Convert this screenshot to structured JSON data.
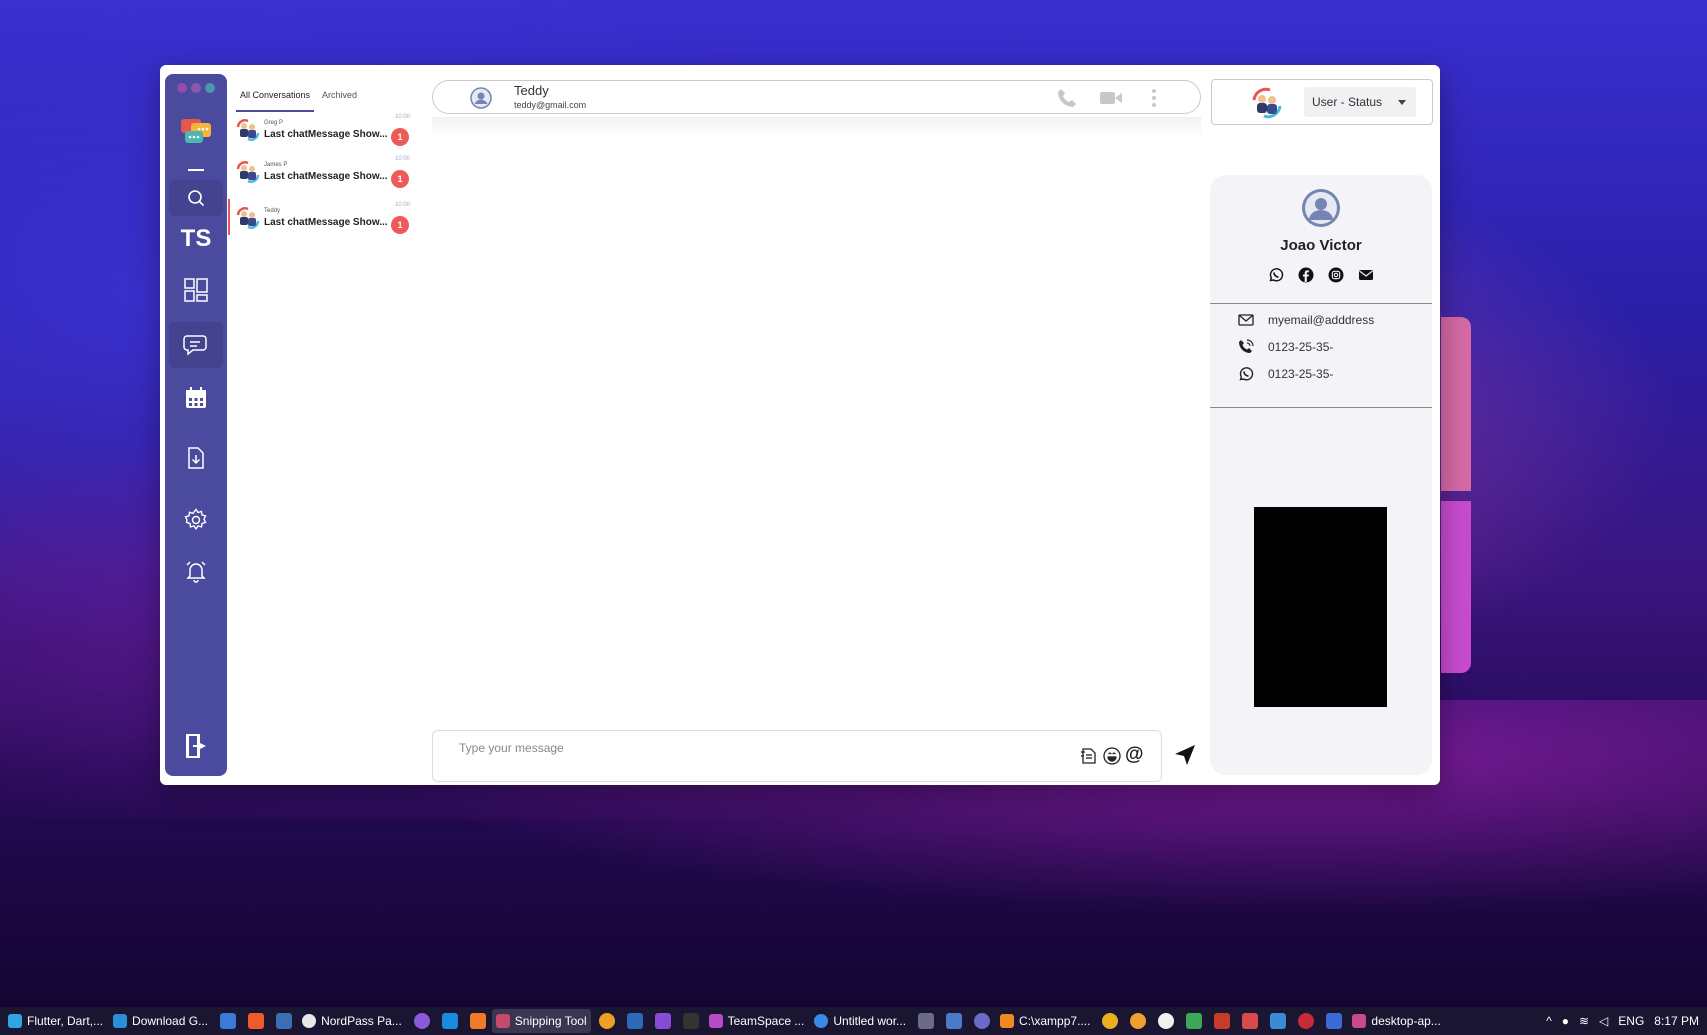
{
  "app": {
    "brand": "TS",
    "conversations_tabs": [
      "All Conversations",
      "Archived"
    ],
    "conversations": [
      {
        "name": "Greg P",
        "message": "Last chatMessage Show...",
        "time": "10:00",
        "unread": "1"
      },
      {
        "name": "James P",
        "message": "Last chatMessage Show...",
        "time": "10:00",
        "unread": "1"
      },
      {
        "name": "Teddy",
        "message": "Last chatMessage Show...",
        "time": "10:00",
        "unread": "1"
      }
    ],
    "chat_header": {
      "name": "Teddy",
      "email": "teddy@gmail.com"
    },
    "user_status": {
      "label": "User - Status"
    },
    "contact": {
      "name": "Joao Victor",
      "email": "myemail@adddress",
      "phone": "0123-25-35-",
      "whatsapp": "0123-25-35-"
    },
    "composer": {
      "placeholder": "Type your message",
      "mention_symbol": "@"
    }
  },
  "rail_icons": [
    "chat-logo-icon",
    "minus-icon",
    "search-icon",
    "dashboard-icon",
    "chat-icon",
    "calendar-icon",
    "file-download-icon",
    "settings-icon",
    "alarm-icon",
    "logout-icon"
  ],
  "colors": {
    "rail": "#4a4a9e",
    "badge": "#ee5a5a",
    "accent": "#4a4a9e"
  },
  "taskbar": {
    "items": [
      {
        "label": "Flutter, Dart,..."
      },
      {
        "label": "Download G..."
      },
      {
        "label": "NordPass Pa..."
      },
      {
        "label": "Snipping Tool"
      },
      {
        "label": "TeamSpace ..."
      },
      {
        "label": "Untitled wor..."
      },
      {
        "label": "C:\\xampp7...."
      },
      {
        "label": "desktop-ap..."
      }
    ],
    "language": "ENG",
    "clock": "8:17 PM"
  }
}
